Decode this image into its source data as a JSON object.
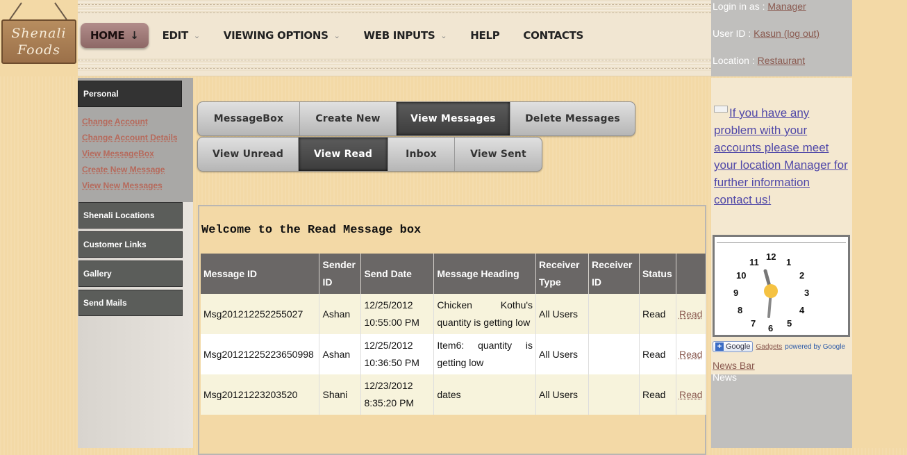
{
  "logo": {
    "line1": "Shenali",
    "line2": "Foods"
  },
  "nav": [
    {
      "label": "HOME",
      "arrow": "↓",
      "active": true
    },
    {
      "label": "EDIT",
      "arrow": "⌄"
    },
    {
      "label": "VIEWING OPTIONS",
      "arrow": "⌄"
    },
    {
      "label": "WEB INPUTS",
      "arrow": "⌄"
    },
    {
      "label": "HELP",
      "arrow": ""
    },
    {
      "label": "CONTACTS",
      "arrow": ""
    }
  ],
  "login": {
    "login_label": "Login in as : ",
    "login_value": "Manager",
    "user_label": "User ID : ",
    "user_value": "Kasun (log out)",
    "location_label": "Location : ",
    "location_value": "Restaurant"
  },
  "sidebar": {
    "personal": "Personal",
    "links": [
      "Change Account",
      "Change Account Details",
      "View MessageBox",
      "Create New Message",
      "View New Messages"
    ],
    "sections": [
      "Shenali Locations",
      "Customer Links",
      "Gallery",
      "Send Mails"
    ]
  },
  "toolbar1": [
    "MessageBox",
    "Create New",
    "View Messages",
    "Delete Messages"
  ],
  "toolbar2": [
    "View Unread",
    "View Read",
    "Inbox",
    "View Sent"
  ],
  "messages": {
    "title": "Welcome to the Read Message box",
    "headers": [
      "Message ID",
      "Sender ID",
      "Send Date",
      "Message Heading",
      "Receiver Type",
      "Receiver ID",
      "Status",
      ""
    ],
    "rows": [
      {
        "id": "Msg201212252255027",
        "sender": "Ashan",
        "date": "12/25/2012 10:55:00 PM",
        "heading": "Chicken Kothu's quantity is getting low",
        "rtype": "All Users",
        "rid": "",
        "status": "Read",
        "action": "Read"
      },
      {
        "id": "Msg20121225223650998",
        "sender": "Ashan",
        "date": "12/25/2012 10:36:50 PM",
        "heading": "Item6: quantity is getting low",
        "rtype": "All Users",
        "rid": "",
        "status": "Read",
        "action": "Read"
      },
      {
        "id": "Msg20121223203520",
        "sender": "Shani",
        "date": "12/23/2012 8:35:20 PM",
        "heading": "dates",
        "rtype": "All Users",
        "rid": "",
        "status": "Read",
        "action": "Read"
      }
    ]
  },
  "right": {
    "notice": "If you have any problem with your accounts please meet your location Manager for further information contact us!",
    "clock_numbers": [
      "12",
      "1",
      "2",
      "3",
      "4",
      "5",
      "6",
      "7",
      "8",
      "9",
      "10",
      "11"
    ],
    "google_button": "Google",
    "gadgets_link": "Gadgets",
    "powered": "powered by Google",
    "newsbar": "News Bar",
    "news": "News"
  },
  "colors": {
    "accent_link": "#8a5a50",
    "notice_text": "#5048a8",
    "nav_active": "#8e6866"
  }
}
